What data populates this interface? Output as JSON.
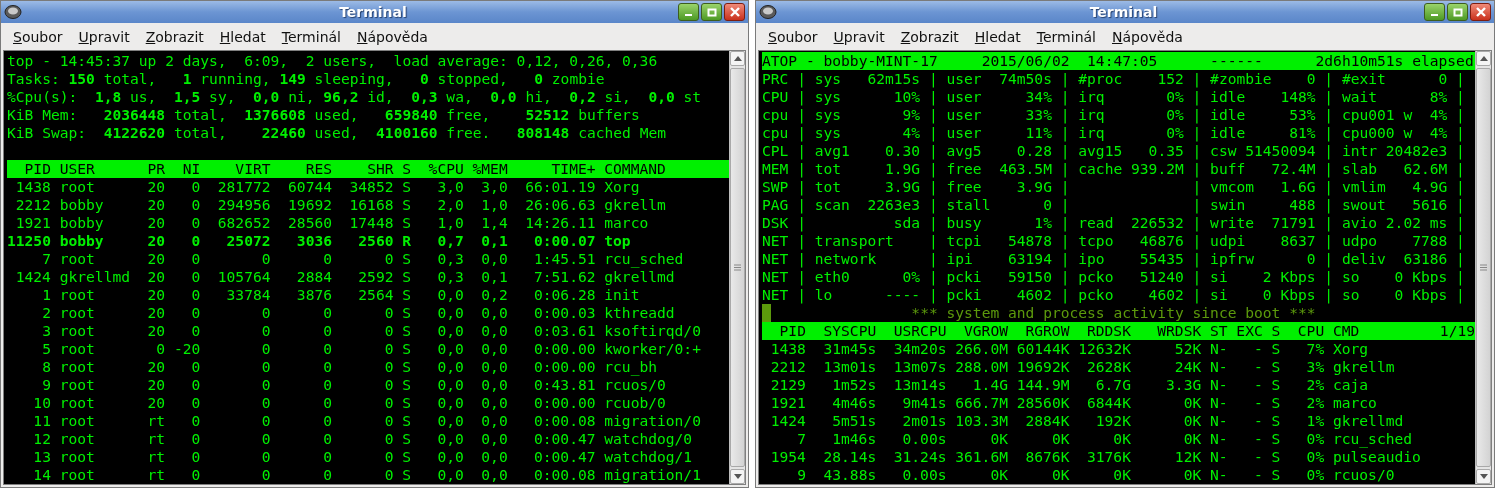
{
  "windows": [
    {
      "kind": "top",
      "title": "Terminal",
      "menu": [
        "Soubor",
        "Upravit",
        "Zobrazit",
        "Hledat",
        "Terminál",
        "Nápověda"
      ],
      "summary": [
        "top - 14:45:37 up 2 days,  6:09,  2 users,  load average: 0,12, 0,26, 0,36",
        "Tasks: **150** total,   **1** running, **149** sleeping,   **0** stopped,   **0** zombie",
        "%Cpu(s):  **1,8** us,  **1,5** sy,  **0,0** ni, **96,2** id,  **0,3** wa,  **0,0** hi,  **0,2** si,  **0,0** st",
        "KiB Mem:   **2036448** total,  **1376608** used,   **659840** free,    **52512** buffers",
        "KiB Swap:  **4122620** total,    **22460** used,  **4100160** free.   **808148** cached Mem"
      ],
      "table": {
        "columns": [
          "PID",
          "USER",
          "PR",
          "NI",
          "VIRT",
          "RES",
          "SHR",
          "S",
          "%CPU",
          "%MEM",
          "TIME+",
          "COMMAND"
        ],
        "rows": [
          {
            "bold": false,
            "cells": [
              "1438",
              "root",
              "20",
              "0",
              "281772",
              "60744",
              "34852",
              "S",
              "3,0",
              "3,0",
              "66:01.19",
              "Xorg"
            ]
          },
          {
            "bold": false,
            "cells": [
              "2212",
              "bobby",
              "20",
              "0",
              "294956",
              "19692",
              "16168",
              "S",
              "2,0",
              "1,0",
              "26:06.63",
              "gkrellm"
            ]
          },
          {
            "bold": false,
            "cells": [
              "1921",
              "bobby",
              "20",
              "0",
              "682652",
              "28560",
              "17448",
              "S",
              "1,0",
              "1,4",
              "14:26.11",
              "marco"
            ]
          },
          {
            "bold": true,
            "cells": [
              "11250",
              "bobby",
              "20",
              "0",
              "25072",
              "3036",
              "2560",
              "R",
              "0,7",
              "0,1",
              "0:00.07",
              "top"
            ]
          },
          {
            "bold": false,
            "cells": [
              "7",
              "root",
              "20",
              "0",
              "0",
              "0",
              "0",
              "S",
              "0,3",
              "0,0",
              "1:45.51",
              "rcu_sched"
            ]
          },
          {
            "bold": false,
            "cells": [
              "1424",
              "gkrellmd",
              "20",
              "0",
              "105764",
              "2884",
              "2592",
              "S",
              "0,3",
              "0,1",
              "7:51.62",
              "gkrellmd"
            ]
          },
          {
            "bold": false,
            "cells": [
              "1",
              "root",
              "20",
              "0",
              "33784",
              "3876",
              "2564",
              "S",
              "0,0",
              "0,2",
              "0:06.28",
              "init"
            ]
          },
          {
            "bold": false,
            "cells": [
              "2",
              "root",
              "20",
              "0",
              "0",
              "0",
              "0",
              "S",
              "0,0",
              "0,0",
              "0:00.03",
              "kthreadd"
            ]
          },
          {
            "bold": false,
            "cells": [
              "3",
              "root",
              "20",
              "0",
              "0",
              "0",
              "0",
              "S",
              "0,0",
              "0,0",
              "0:03.61",
              "ksoftirqd/0"
            ]
          },
          {
            "bold": false,
            "cells": [
              "5",
              "root",
              "0",
              "-20",
              "0",
              "0",
              "0",
              "S",
              "0,0",
              "0,0",
              "0:00.00",
              "kworker/0:+"
            ]
          },
          {
            "bold": false,
            "cells": [
              "8",
              "root",
              "20",
              "0",
              "0",
              "0",
              "0",
              "S",
              "0,0",
              "0,0",
              "0:00.00",
              "rcu_bh"
            ]
          },
          {
            "bold": false,
            "cells": [
              "9",
              "root",
              "20",
              "0",
              "0",
              "0",
              "0",
              "S",
              "0,0",
              "0,0",
              "0:43.81",
              "rcuos/0"
            ]
          },
          {
            "bold": false,
            "cells": [
              "10",
              "root",
              "20",
              "0",
              "0",
              "0",
              "0",
              "S",
              "0,0",
              "0,0",
              "0:00.00",
              "rcuob/0"
            ]
          },
          {
            "bold": false,
            "cells": [
              "11",
              "root",
              "rt",
              "0",
              "0",
              "0",
              "0",
              "S",
              "0,0",
              "0,0",
              "0:00.08",
              "migration/0"
            ]
          },
          {
            "bold": false,
            "cells": [
              "12",
              "root",
              "rt",
              "0",
              "0",
              "0",
              "0",
              "S",
              "0,0",
              "0,0",
              "0:00.47",
              "watchdog/0"
            ]
          },
          {
            "bold": false,
            "cells": [
              "13",
              "root",
              "rt",
              "0",
              "0",
              "0",
              "0",
              "S",
              "0,0",
              "0,0",
              "0:00.47",
              "watchdog/1"
            ]
          },
          {
            "bold": false,
            "cells": [
              "14",
              "root",
              "rt",
              "0",
              "0",
              "0",
              "0",
              "S",
              "0,0",
              "0,0",
              "0:00.08",
              "migration/1"
            ]
          }
        ]
      }
    },
    {
      "kind": "atop",
      "title": "Terminal",
      "menu": [
        "Soubor",
        "Upravit",
        "Zobrazit",
        "Hledat",
        "Terminál",
        "Nápověda"
      ],
      "header": "ATOP - bobby-MINT-17     2015/06/02  14:47:05      ------      2d6h10m51s elapsed",
      "stats": [
        "PRC | sys   62m15s | user  74m50s | #proc    152 | #zombie    0 | #exit      0 |",
        "CPU | sys      10% | user     34% | irq       0% | idle    148% | wait      8% |",
        "cpu | sys       9% | user     33% | irq       0% | idle     53% | cpu001 w  4% |",
        "cpu | sys       4% | user     11% | irq       0% | idle     81% | cpu000 w  4% |",
        "CPL | avg1    0.30 | avg5    0.28 | avg15   0.35 | csw 51450094 | intr 20482e3 |",
        "MEM | tot     1.9G | free  463.5M | cache 939.2M | buff   72.4M | slab   62.6M |",
        "SWP | tot     3.9G | free    3.9G |              | vmcom   1.6G | vmlim   4.9G |",
        "PAG | scan  2263e3 | stall      0 |              | swin     488 | swout   5616 |",
        "DSK |          sda | busy      1% | read  226532 | write  71791 | avio 2.02 ms |",
        "NET | transport    | tcpi   54878 | tcpo   46876 | udpi    8637 | udpo    7788 |",
        "NET | network      | ipi    63194 | ipo    55435 | ipfrw      0 | deliv  63186 |",
        "NET | eth0      0% | pcki   59150 | pcko   51240 | si    2 Kbps | so    0 Kbps |",
        "NET | lo      ---- | pcki    4602 | pcko    4602 | si    0 Kbps | so    0 Kbps |"
      ],
      "banner": "*** system and process activity since boot ***",
      "table": {
        "columns": [
          "PID",
          "SYSCPU",
          "USRCPU",
          "VGROW",
          "RGROW",
          "RDDSK",
          "WRDSK",
          "ST",
          "EXC",
          "S",
          "CPU",
          "CMD"
        ],
        "page": "1/19",
        "rows": [
          {
            "cells": [
              "1438",
              "31m45s",
              "34m20s",
              "266.0M",
              "60144K",
              "12632K",
              "52K",
              "N-",
              "-",
              "S",
              "7%",
              "Xorg"
            ]
          },
          {
            "cells": [
              "2212",
              "13m01s",
              "13m07s",
              "288.0M",
              "19692K",
              "2628K",
              "24K",
              "N-",
              "-",
              "S",
              "3%",
              "gkrellm"
            ]
          },
          {
            "cells": [
              "2129",
              "1m52s",
              "13m14s",
              "1.4G",
              "144.9M",
              "6.7G",
              "3.3G",
              "N-",
              "-",
              "S",
              "2%",
              "caja"
            ]
          },
          {
            "cells": [
              "1921",
              "4m46s",
              "9m41s",
              "666.7M",
              "28560K",
              "6844K",
              "0K",
              "N-",
              "-",
              "S",
              "2%",
              "marco"
            ]
          },
          {
            "cells": [
              "1424",
              "5m51s",
              "2m01s",
              "103.3M",
              "2884K",
              "192K",
              "0K",
              "N-",
              "-",
              "S",
              "1%",
              "gkrellmd"
            ]
          },
          {
            "cells": [
              "7",
              "1m46s",
              "0.00s",
              "0K",
              "0K",
              "0K",
              "0K",
              "N-",
              "-",
              "S",
              "0%",
              "rcu_sched"
            ]
          },
          {
            "cells": [
              "1954",
              "28.14s",
              "31.24s",
              "361.6M",
              "8676K",
              "3176K",
              "12K",
              "N-",
              "-",
              "S",
              "0%",
              "pulseaudio"
            ]
          },
          {
            "cells": [
              "9",
              "43.88s",
              "0.00s",
              "0K",
              "0K",
              "0K",
              "0K",
              "N-",
              "-",
              "S",
              "0%",
              "rcuos/0"
            ]
          }
        ]
      }
    }
  ]
}
